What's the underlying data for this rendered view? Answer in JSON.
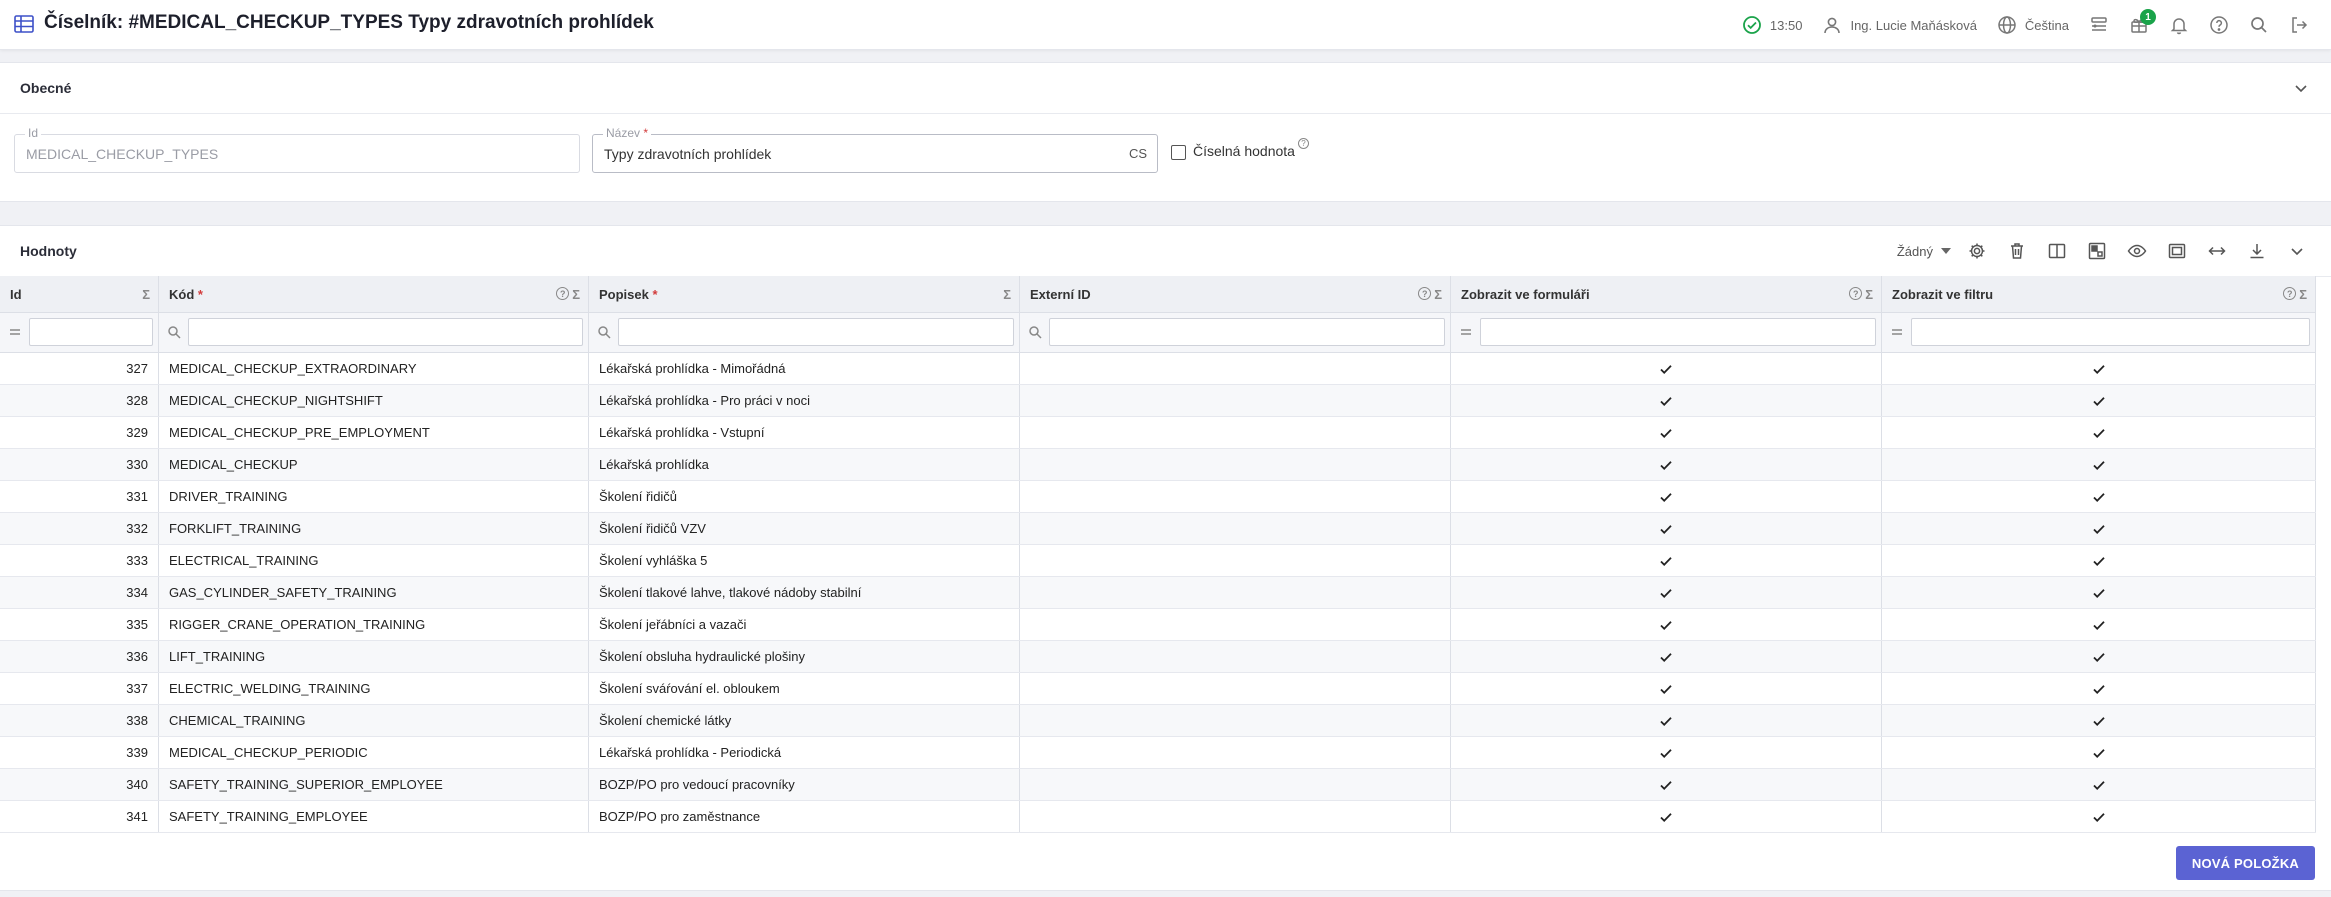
{
  "header": {
    "title": "Číselník: #MEDICAL_CHECKUP_TYPES Typy zdravotních prohlídek",
    "time": "13:50",
    "user": "Ing. Lucie Maňásková",
    "language": "Čeština",
    "notification_badge": "1"
  },
  "general": {
    "section_title": "Obecné",
    "id_label": "Id",
    "id_value": "MEDICAL_CHECKUP_TYPES",
    "name_label": "Název",
    "name_required": "*",
    "name_value": "Typy zdravotních prohlídek",
    "name_lang": "CS",
    "numeric_label": "Číselná hodnota",
    "help_glyph": "?"
  },
  "values": {
    "section_title": "Hodnoty",
    "view_select": "Žádný",
    "columns": [
      {
        "label": "Id",
        "required": ""
      },
      {
        "label": "Kód",
        "required": "*"
      },
      {
        "label": "Popisek",
        "required": "*"
      },
      {
        "label": "Externí ID",
        "required": ""
      },
      {
        "label": "Zobrazit ve formuláři",
        "required": ""
      },
      {
        "label": "Zobrazit ve filtru",
        "required": ""
      }
    ],
    "rows": [
      {
        "id": "327",
        "code": "MEDICAL_CHECKUP_EXTRAORDINARY",
        "label": "Lékařská prohlídka - Mimořádná",
        "ext": ""
      },
      {
        "id": "328",
        "code": "MEDICAL_CHECKUP_NIGHTSHIFT",
        "label": "Lékařská prohlídka - Pro práci v noci",
        "ext": ""
      },
      {
        "id": "329",
        "code": "MEDICAL_CHECKUP_PRE_EMPLOYMENT",
        "label": "Lékařská prohlídka - Vstupní",
        "ext": ""
      },
      {
        "id": "330",
        "code": "MEDICAL_CHECKUP",
        "label": "Lékařská prohlídka",
        "ext": ""
      },
      {
        "id": "331",
        "code": "DRIVER_TRAINING",
        "label": "Školení řidičů",
        "ext": ""
      },
      {
        "id": "332",
        "code": "FORKLIFT_TRAINING",
        "label": "Školení řidičů VZV",
        "ext": ""
      },
      {
        "id": "333",
        "code": "ELECTRICAL_TRAINING",
        "label": "Školení vyhláška 5",
        "ext": ""
      },
      {
        "id": "334",
        "code": "GAS_CYLINDER_SAFETY_TRAINING",
        "label": "Školení tlakové lahve, tlakové nádoby stabilní",
        "ext": ""
      },
      {
        "id": "335",
        "code": "RIGGER_CRANE_OPERATION_TRAINING",
        "label": "Školení jeřábníci a vazači",
        "ext": ""
      },
      {
        "id": "336",
        "code": "LIFT_TRAINING",
        "label": "Školení obsluha hydraulické plošiny",
        "ext": ""
      },
      {
        "id": "337",
        "code": "ELECTRIC_WELDING_TRAINING",
        "label": "Školení sváŕování el. obloukem",
        "ext": ""
      },
      {
        "id": "338",
        "code": "CHEMICAL_TRAINING",
        "label": "Školení chemické látky",
        "ext": ""
      },
      {
        "id": "339",
        "code": "MEDICAL_CHECKUP_PERIODIC",
        "label": "Lékařská prohlídka - Periodická",
        "ext": ""
      },
      {
        "id": "340",
        "code": "SAFETY_TRAINING_SUPERIOR_EMPLOYEE",
        "label": "BOZP/PO pro vedoucí pracovníky",
        "ext": ""
      },
      {
        "id": "341",
        "code": "SAFETY_TRAINING_EMPLOYEE",
        "label": "BOZP/PO pro zaměstnance",
        "ext": ""
      }
    ],
    "new_button": "NOVÁ POLOŽKA"
  },
  "colors": {
    "accent": "#5b63d3",
    "ok": "#1aa34a"
  }
}
